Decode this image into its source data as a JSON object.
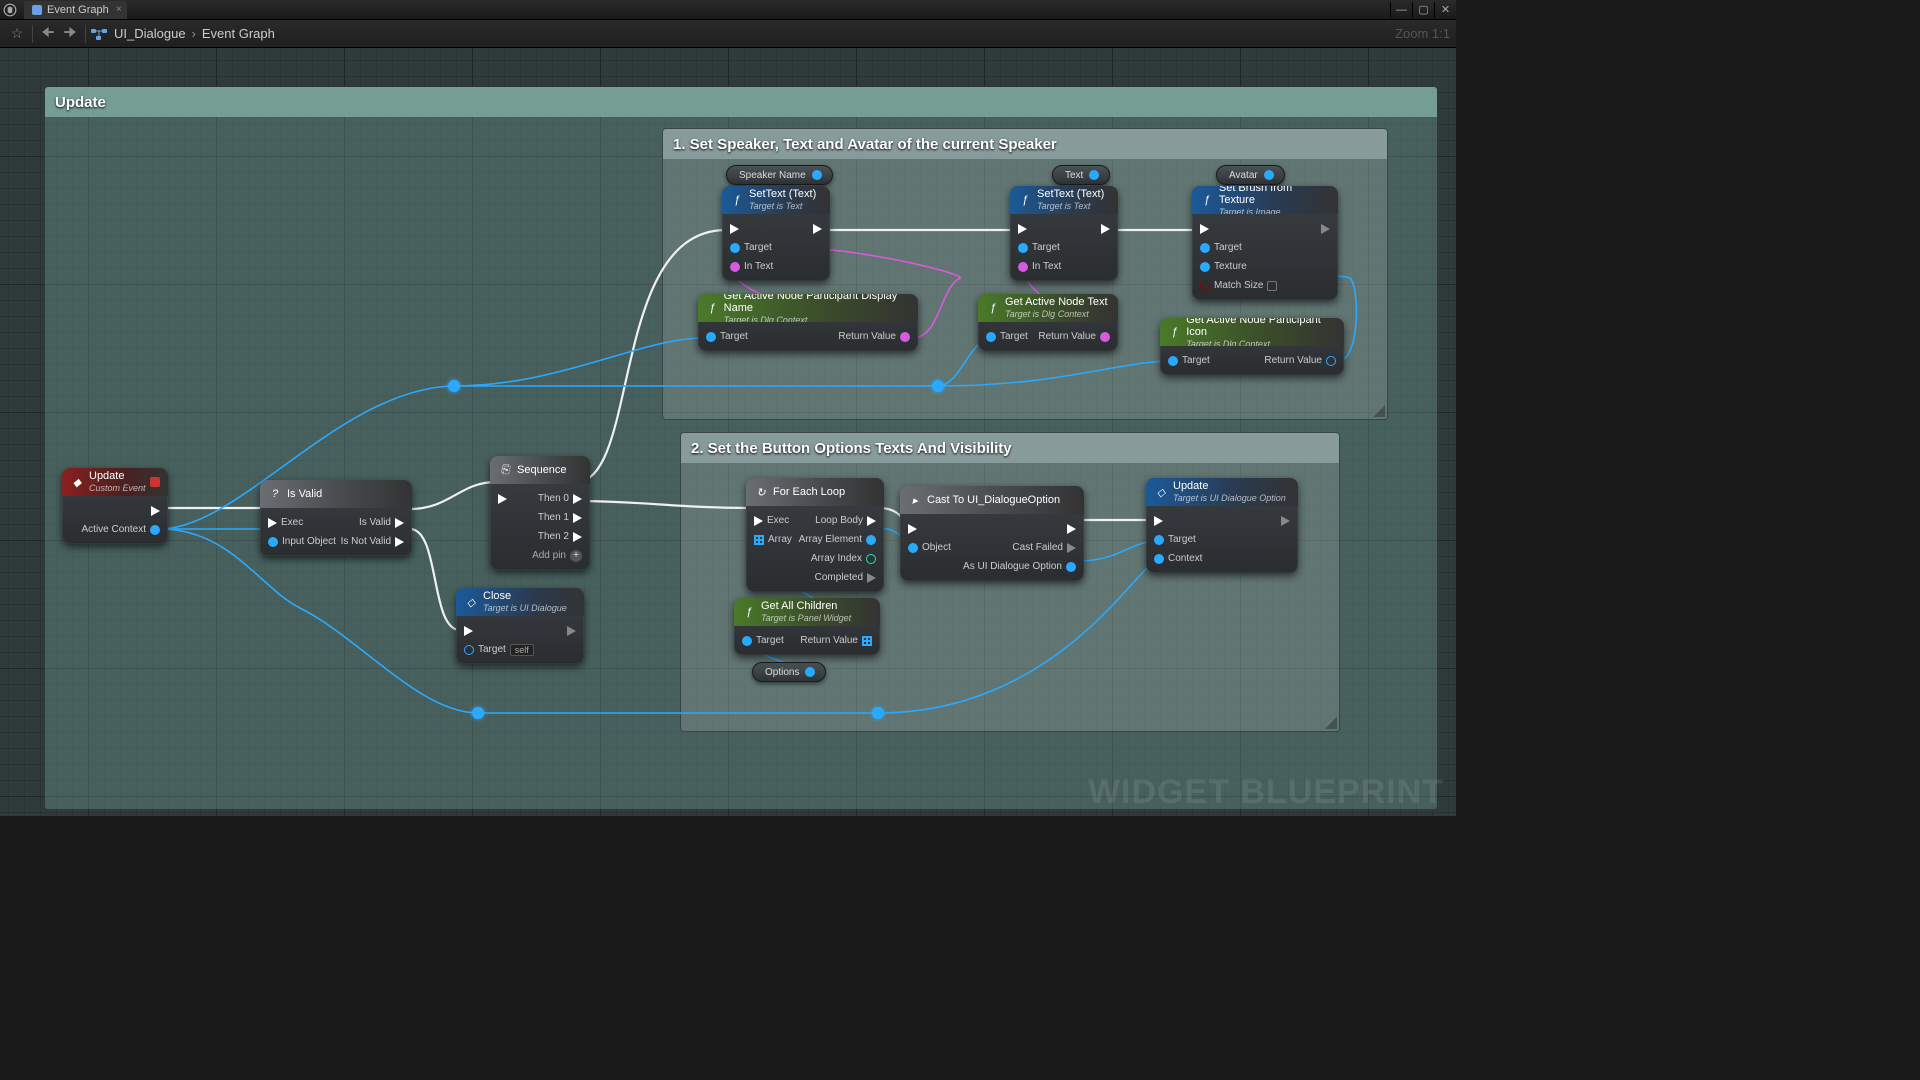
{
  "titlebar": {
    "tab": "Event Graph"
  },
  "toolbar": {
    "breadcrumb": {
      "root": "UI_Dialogue",
      "leaf": "Event Graph"
    },
    "zoom": "Zoom 1:1"
  },
  "watermark": "WIDGET BLUEPRINT",
  "comments": {
    "main": "Update",
    "group1": "1. Set Speaker, Text and Avatar of the current Speaker",
    "group2": "2. Set the Button Options Texts And Visibility"
  },
  "pills": {
    "speakerName": "Speaker Name",
    "text": "Text",
    "avatar": "Avatar",
    "options": "Options"
  },
  "nodes": {
    "updateEvent": {
      "title": "Update",
      "sub": "Custom Event",
      "out": "Active Context"
    },
    "isValid": {
      "title": "Is Valid",
      "pins": {
        "exec": "Exec",
        "input": "Input Object",
        "valid": "Is Valid",
        "notValid": "Is Not Valid"
      }
    },
    "sequence": {
      "title": "Sequence",
      "pins": {
        "then0": "Then 0",
        "then1": "Then 1",
        "then2": "Then 2",
        "add": "Add pin"
      }
    },
    "close": {
      "title": "Close",
      "sub": "Target is UI Dialogue",
      "pins": {
        "target": "Target",
        "self": "self"
      }
    },
    "setText": {
      "title": "SetText (Text)",
      "sub": "Target is Text",
      "pins": {
        "target": "Target",
        "inText": "In Text"
      }
    },
    "setBrush": {
      "title": "Set Brush from Texture",
      "sub": "Target is Image",
      "pins": {
        "target": "Target",
        "texture": "Texture",
        "matchSize": "Match Size"
      }
    },
    "getName": {
      "title": "Get Active Node Participant Display Name",
      "sub": "Target is Dlg Context",
      "pins": {
        "target": "Target",
        "ret": "Return Value"
      }
    },
    "getText": {
      "title": "Get Active Node Text",
      "sub": "Target is Dlg Context",
      "pins": {
        "target": "Target",
        "ret": "Return Value"
      }
    },
    "getIcon": {
      "title": "Get Active Node Participant Icon",
      "sub": "Target is Dlg Context",
      "pins": {
        "target": "Target",
        "ret": "Return Value"
      }
    },
    "forEach": {
      "title": "For Each Loop",
      "pins": {
        "exec": "Exec",
        "array": "Array",
        "body": "Loop Body",
        "elem": "Array Element",
        "idx": "Array Index",
        "done": "Completed"
      }
    },
    "cast": {
      "title": "Cast To UI_DialogueOption",
      "pins": {
        "object": "Object",
        "failed": "Cast Failed",
        "as": "As UI Dialogue Option"
      }
    },
    "updateOpt": {
      "title": "Update",
      "sub": "Target is UI Dialogue Option",
      "pins": {
        "target": "Target",
        "context": "Context"
      }
    },
    "getChildren": {
      "title": "Get All Children",
      "sub": "Target is Panel Widget",
      "pins": {
        "target": "Target",
        "ret": "Return Value"
      }
    }
  }
}
